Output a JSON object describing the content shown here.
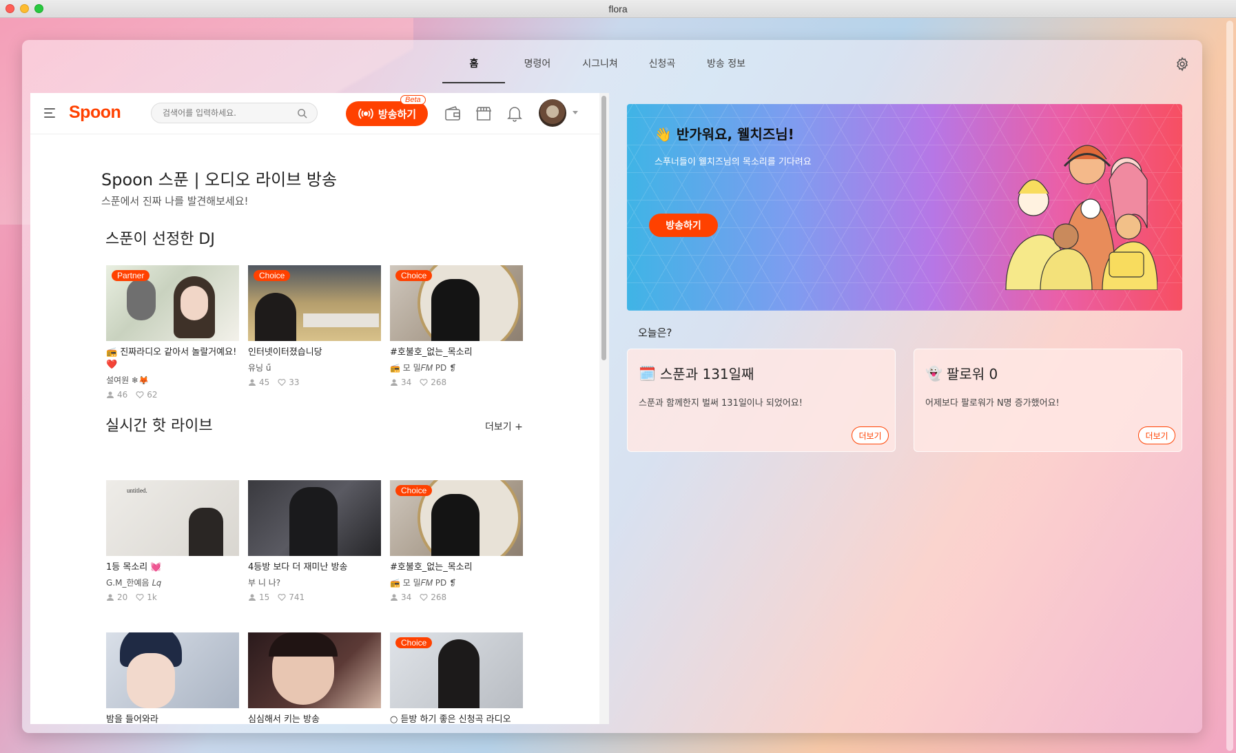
{
  "window": {
    "title": "flora"
  },
  "nav": {
    "tabs": [
      {
        "label": "홈"
      },
      {
        "label": "명령어"
      },
      {
        "label": "시그니쳐"
      },
      {
        "label": "신청곡"
      },
      {
        "label": "방송 정보"
      }
    ],
    "active_tab": "홈"
  },
  "webview": {
    "logo": "Spoon",
    "search_placeholder": "검색어를 입력하세요.",
    "live_button": "방송하기",
    "beta_badge": "Beta",
    "page_title": "Spoon 스푼 | 오디오 라이브 방송",
    "page_subtitle": "스푼에서 진짜 나를 발견해보세요!",
    "section_dj": "스푼이 선정한 DJ",
    "section_live": "실시간 핫 라이브",
    "more_label": "더보기 +",
    "dj_cards": [
      {
        "badge": "Partner",
        "title": "📻 진짜라디오 같아서 놀랄거예요! ❤️",
        "dj": "설여원 ❄🦊",
        "listeners": "46",
        "likes": "62"
      },
      {
        "badge": "Choice",
        "title": "인터넷이터졌습니당",
        "dj": "유닝 ű",
        "listeners": "45",
        "likes": "33"
      },
      {
        "badge": "Choice",
        "title": "#호불호_없는_목소리",
        "dj": "📻 모 밀𝐹𝑀 PD ❡",
        "listeners": "34",
        "likes": "268"
      }
    ],
    "live_cards": [
      {
        "badge": "",
        "title": "1등 목소리 💓",
        "dj": "G.M_한예음 𝐿𝑞",
        "listeners": "20",
        "likes": "1k"
      },
      {
        "badge": "",
        "title": "4등방 보다 더 재미난 방송",
        "dj": "부 니 나?",
        "listeners": "15",
        "likes": "741"
      },
      {
        "badge": "Choice",
        "title": "#호불호_없는_목소리",
        "dj": "📻 모 밀𝐹𝑀 PD ❡",
        "listeners": "34",
        "likes": "268"
      }
    ],
    "row3_cards": [
      {
        "badge": "",
        "title": "밤을 들어와라"
      },
      {
        "badge": "",
        "title": "심심해서 키는 방송"
      },
      {
        "badge": "Choice",
        "title": "○ 듣방 하기 좋은 신청곡 라디오"
      }
    ]
  },
  "hero": {
    "title": "👋 반가워요, 웰치즈님!",
    "subtitle": "스푸너들이 웰치즈님의 목소리를 기다려요",
    "button": "방송하기"
  },
  "today": {
    "label": "오늘은?",
    "cards": [
      {
        "icon": "🗓️",
        "title": "스푼과 131일째",
        "desc": "스푼과 함께한지 벌써 131일이나 되었어요!",
        "more": "더보기"
      },
      {
        "icon": "👻",
        "title": "팔로워 0",
        "desc": "어제보다 팔로워가 N명 증가했어요!",
        "more": "더보기"
      }
    ]
  },
  "colors": {
    "accent": "#ff4100",
    "hero_from": "#3fb4e6",
    "hero_to": "#f74f62"
  }
}
